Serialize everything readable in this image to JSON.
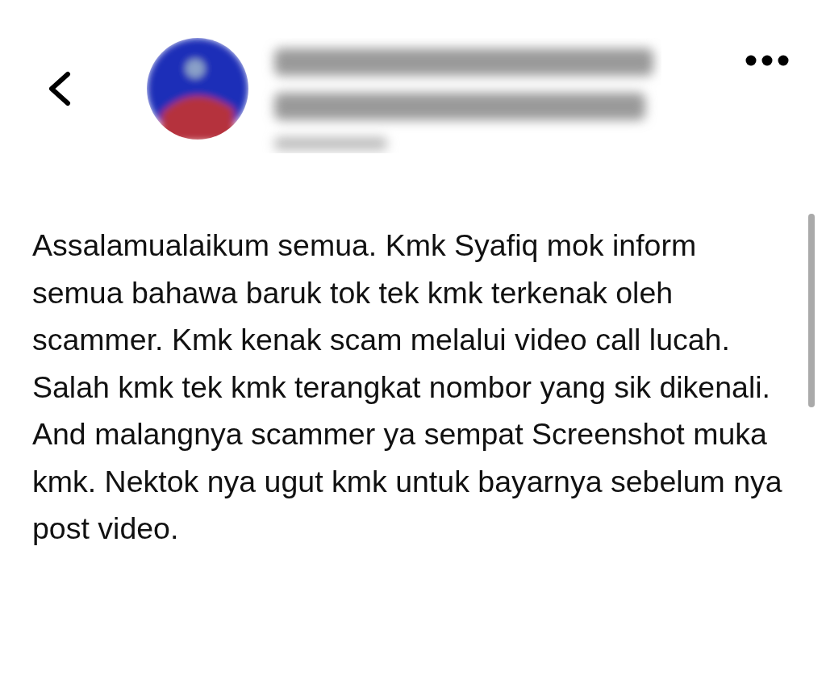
{
  "post": {
    "text": "Assalamualaikum semua. Kmk Syafiq mok inform semua bahawa baruk tok tek kmk terkenak oleh scammer. Kmk kenak scam melalui video call lucah. Salah kmk tek kmk terangkat nombor yang sik dikenali. And malangnya scammer ya sempat Screenshot muka kmk. Nektok nya ugut kmk untuk bayarnya sebelum nya post video."
  }
}
